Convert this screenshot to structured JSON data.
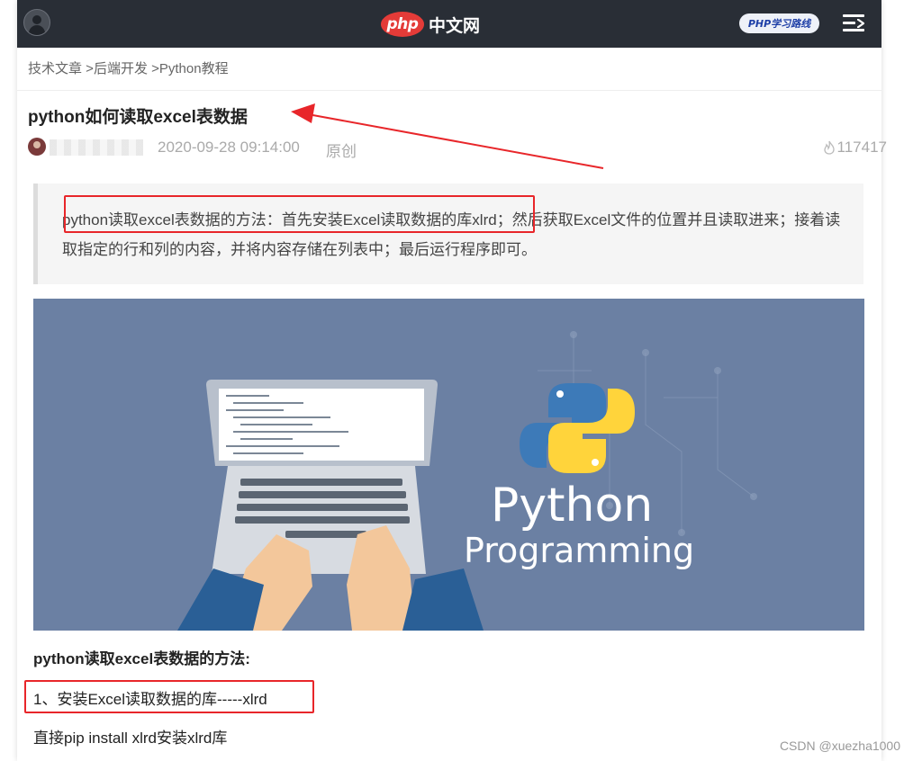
{
  "header": {
    "logo_badge": "php",
    "site_name": "中文网",
    "route_badge": "PHP学习路线"
  },
  "breadcrumb": {
    "items": [
      "技术文章 >",
      "后端开发 >",
      "Python教程"
    ]
  },
  "article": {
    "title": "python如何读取excel表数据",
    "date": "2020-09-28 09:14:00",
    "type": "原创",
    "views": "117417",
    "summary": "python读取excel表数据的方法：首先安装Excel读取数据的库xlrd；然后获取Excel文件的位置并且读取进来；接着读取指定的行和列的内容，并将内容存储在列表中；最后运行程序即可。",
    "banner": {
      "title": "Python",
      "subtitle": "Programming"
    },
    "section_heading": "python读取excel表数据的方法:",
    "step1": "1、安装Excel读取数据的库-----xlrd",
    "step1_desc": "直接pip install xlrd安装xlrd库"
  },
  "watermark": "CSDN @xuezha1000",
  "colors": {
    "header_bg": "#292e36",
    "php_red": "#e43b38",
    "annotation_red": "#e8262a",
    "banner_bg": "#6b80a3"
  },
  "icons": [
    "user-avatar-icon",
    "menu-icon",
    "fire-icon",
    "python-logo-icon",
    "laptop-illustration"
  ]
}
